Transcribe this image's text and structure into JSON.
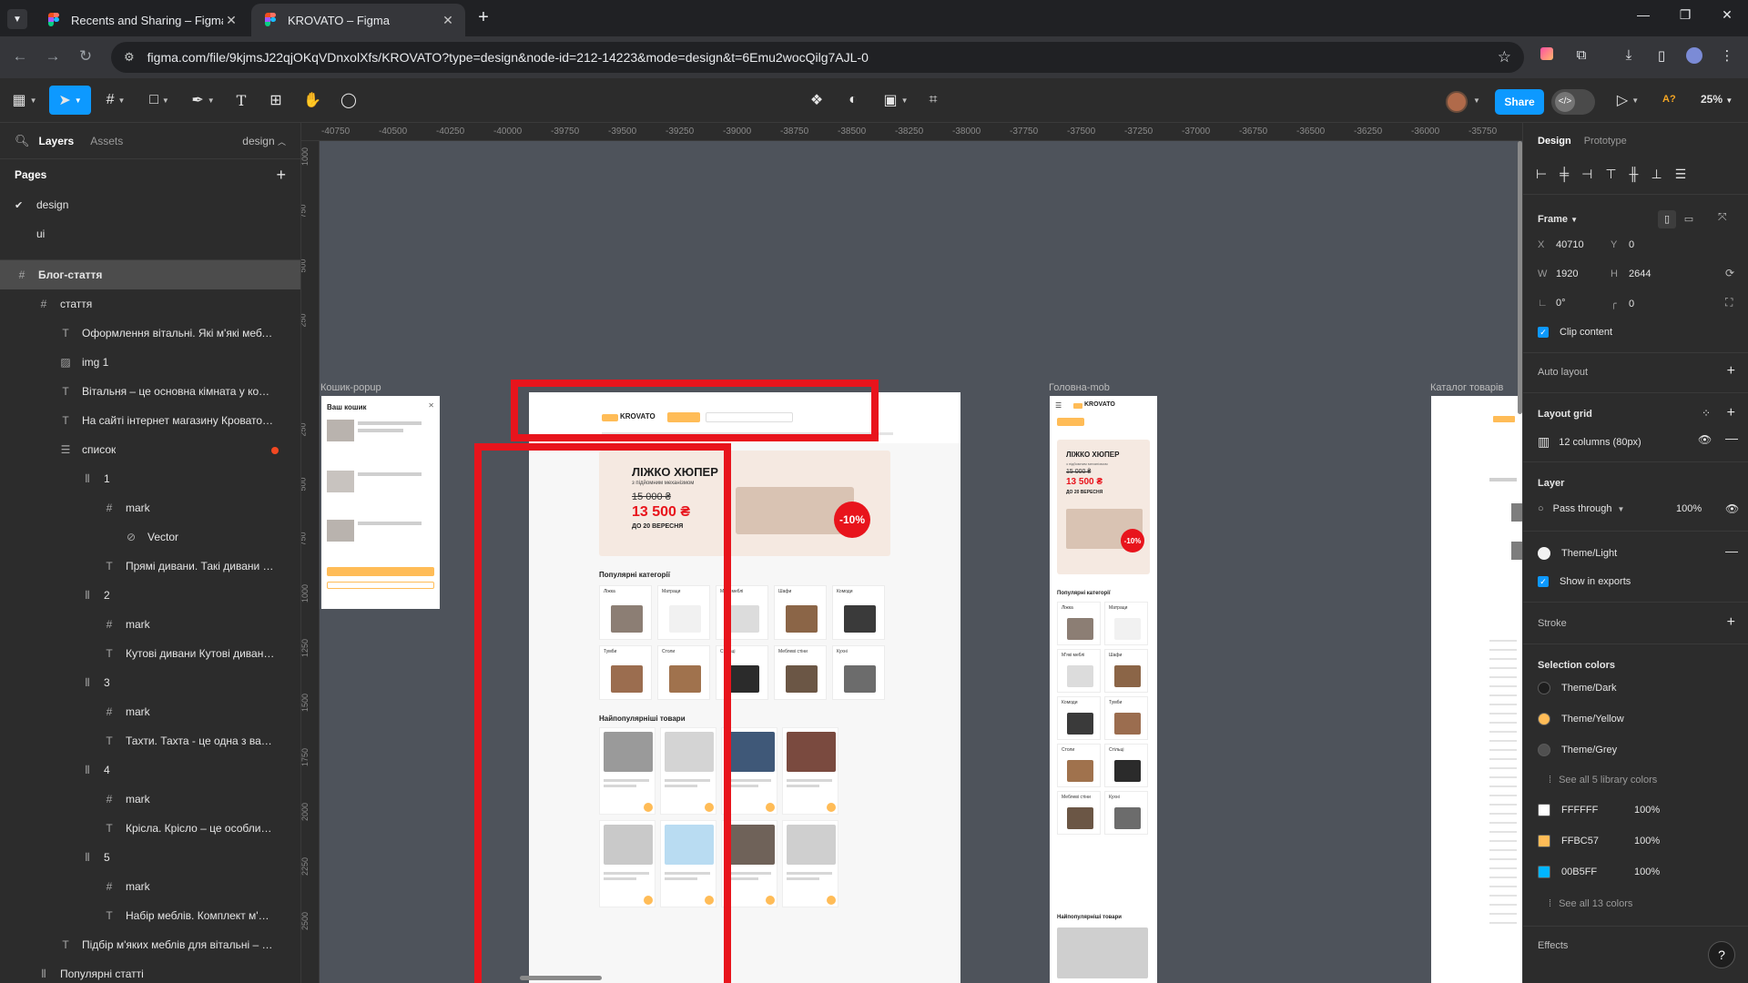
{
  "browser": {
    "tabs": [
      {
        "title": "Recents and Sharing – Figma",
        "active": false
      },
      {
        "title": "KROVATO – Figma",
        "active": true
      }
    ],
    "url": "figma.com/file/9kjmsJ22qjOKqVDnxolXfs/KROVATO?type=design&node-id=212-14223&mode=design&t=6Emu2wocQilg7AJL-0"
  },
  "toolbar": {
    "share_label": "Share",
    "zoom_label": "25%",
    "ai_label": "A?"
  },
  "left_panel": {
    "tab_layers": "Layers",
    "tab_assets": "Assets",
    "page_select": "design",
    "pages_title": "Pages",
    "pages": [
      {
        "name": "design",
        "current": true
      },
      {
        "name": "ui",
        "current": false
      }
    ],
    "layers": [
      {
        "name": "Блог-стаття",
        "icon": "frame-icon",
        "indent": 0,
        "selected": true
      },
      {
        "name": "стаття",
        "icon": "frame-icon",
        "indent": 1
      },
      {
        "name": "Оформлення вітальні. Які м'які меблі кра...",
        "icon": "text-icon",
        "indent": 2
      },
      {
        "name": "img 1",
        "icon": "image-icon",
        "indent": 2
      },
      {
        "name": "Вітальня – це основна кімната у кожному...",
        "icon": "text-icon",
        "indent": 2
      },
      {
        "name": "На сайті інтернет магазину Кровато пред...",
        "icon": "text-icon",
        "indent": 2
      },
      {
        "name": "список",
        "icon": "autolayout-vertical-icon",
        "indent": 2,
        "dot": true
      },
      {
        "name": "1",
        "icon": "autolayout-horizontal-icon",
        "indent": 3
      },
      {
        "name": "mark",
        "icon": "frame-icon",
        "indent": 4
      },
      {
        "name": "Vector",
        "icon": "vector-icon",
        "indent": 5
      },
      {
        "name": "Прямі дивани. Такі дивани вваж...",
        "icon": "text-icon",
        "indent": 4
      },
      {
        "name": "2",
        "icon": "autolayout-horizontal-icon",
        "indent": 3
      },
      {
        "name": "mark",
        "icon": "frame-icon",
        "indent": 4
      },
      {
        "name": "Кутові дивани Кутові дивани вва...",
        "icon": "text-icon",
        "indent": 4
      },
      {
        "name": "3",
        "icon": "autolayout-horizontal-icon",
        "indent": 3
      },
      {
        "name": "mark",
        "icon": "frame-icon",
        "indent": 4
      },
      {
        "name": "Тахти. Тахта - це одна з варіаці...",
        "icon": "text-icon",
        "indent": 4
      },
      {
        "name": "4",
        "icon": "autolayout-horizontal-icon",
        "indent": 3
      },
      {
        "name": "mark",
        "icon": "frame-icon",
        "indent": 4
      },
      {
        "name": "Крісла. Крісло – це особливий п...",
        "icon": "text-icon",
        "indent": 4
      },
      {
        "name": "5",
        "icon": "autolayout-horizontal-icon",
        "indent": 3
      },
      {
        "name": "mark",
        "icon": "frame-icon",
        "indent": 4
      },
      {
        "name": "Набір меблів. Комплект м'яких ...",
        "icon": "text-icon",
        "indent": 4
      },
      {
        "name": "Підбір м'яких меблів для вітальні – це за...",
        "icon": "text-icon",
        "indent": 2
      },
      {
        "name": "Популярні статті",
        "icon": "autolayout-horizontal-icon",
        "indent": 1
      }
    ]
  },
  "canvas": {
    "ruler_x": [
      "-40750",
      "-40500",
      "-40250",
      "-40000",
      "-39750",
      "-39500",
      "-39250",
      "-39000",
      "-38750",
      "-38500",
      "-38250",
      "-38000",
      "-37750",
      "-37500",
      "-37250",
      "-37000",
      "-36750",
      "-36500",
      "-36250",
      "-36000",
      "-35750"
    ],
    "ruler_y": [
      "1000",
      "750",
      "500",
      "250",
      "0",
      "250",
      "500",
      "750",
      "1000",
      "1250",
      "1500",
      "1750",
      "2000",
      "2250",
      "2500"
    ],
    "frames": [
      {
        "label": "Кошик-popup"
      },
      {
        "label": "Головна-mob"
      },
      {
        "label": "Каталог товарів"
      }
    ],
    "main_frame": {
      "logo": "KROVATO",
      "hero_title": "ЛІЖКО ХЮПЕР",
      "hero_subtitle": "з підйомним механізмом",
      "hero_old_price": "15 000 ₴",
      "hero_new_price": "13 500 ₴",
      "hero_until": "ДО 20 ВЕРЕСНЯ",
      "hero_badge": "-10%",
      "categories_title": "Популярні категорії",
      "categories": [
        "Ліжка",
        "Матраци",
        "М'які меблі",
        "Шафи",
        "Комоди",
        "Тумби",
        "Столи",
        "Стільці",
        "Меблеві стіни",
        "Кухні"
      ],
      "products_title": "Найпопулярніші товари"
    },
    "popup": {
      "title": "Ваш кошик"
    },
    "mobile": {
      "logo": "KROVATO",
      "hero_title": "ЛІЖКО ХЮПЕР",
      "hero_subtitle": "з підйомним механізмом",
      "hero_old_price": "15 000 ₴",
      "hero_new_price": "13 500 ₴",
      "hero_until": "ДО 20 ВЕРЕСНЯ",
      "hero_badge": "-10%",
      "categories_title": "Популярні категорії",
      "categories": [
        "Ліжка",
        "Матраци",
        "М'які меблі",
        "Шафи",
        "Комоди",
        "Тумби",
        "Столи",
        "Стільці",
        "Меблеві стіни",
        "Кухні"
      ],
      "products_title": "Найпопулярніші товари"
    }
  },
  "right_panel": {
    "tab_design": "Design",
    "tab_prototype": "Prototype",
    "frame_title": "Frame",
    "x_label": "X",
    "x_value": "40710",
    "y_label": "Y",
    "y_value": "0",
    "w_label": "W",
    "w_value": "1920",
    "h_label": "H",
    "h_value": "2644",
    "rotation": "0°",
    "radius": "0",
    "clip_content": "Clip content",
    "auto_layout": "Auto layout",
    "layout_grid": "Layout grid",
    "grid_value": "12 columns (80px)",
    "layer_title": "Layer",
    "blend_mode": "Pass through",
    "opacity": "100%",
    "theme": "Theme/Light",
    "show_in_exports": "Show in exports",
    "stroke": "Stroke",
    "selection_colors": "Selection colors",
    "library_colors": [
      {
        "name": "Theme/Dark",
        "color": "#1e1e1e"
      },
      {
        "name": "Theme/Yellow",
        "color": "#ffbc57"
      },
      {
        "name": "Theme/Grey",
        "color": "#505050"
      }
    ],
    "see_library": "See all 5 library colors",
    "colors": [
      {
        "hex": "FFFFFF",
        "opacity": "100%",
        "color": "#ffffff"
      },
      {
        "hex": "FFBC57",
        "opacity": "100%",
        "color": "#ffbc57"
      },
      {
        "hex": "00B5FF",
        "opacity": "100%",
        "color": "#00b5ff"
      }
    ],
    "see_all_colors": "See all 13 colors",
    "effects": "Effects",
    "help": "?"
  },
  "colors": {
    "accent": "#0d99ff",
    "highlight_box": "#e8141c",
    "brand_yellow": "#ffbc57"
  }
}
